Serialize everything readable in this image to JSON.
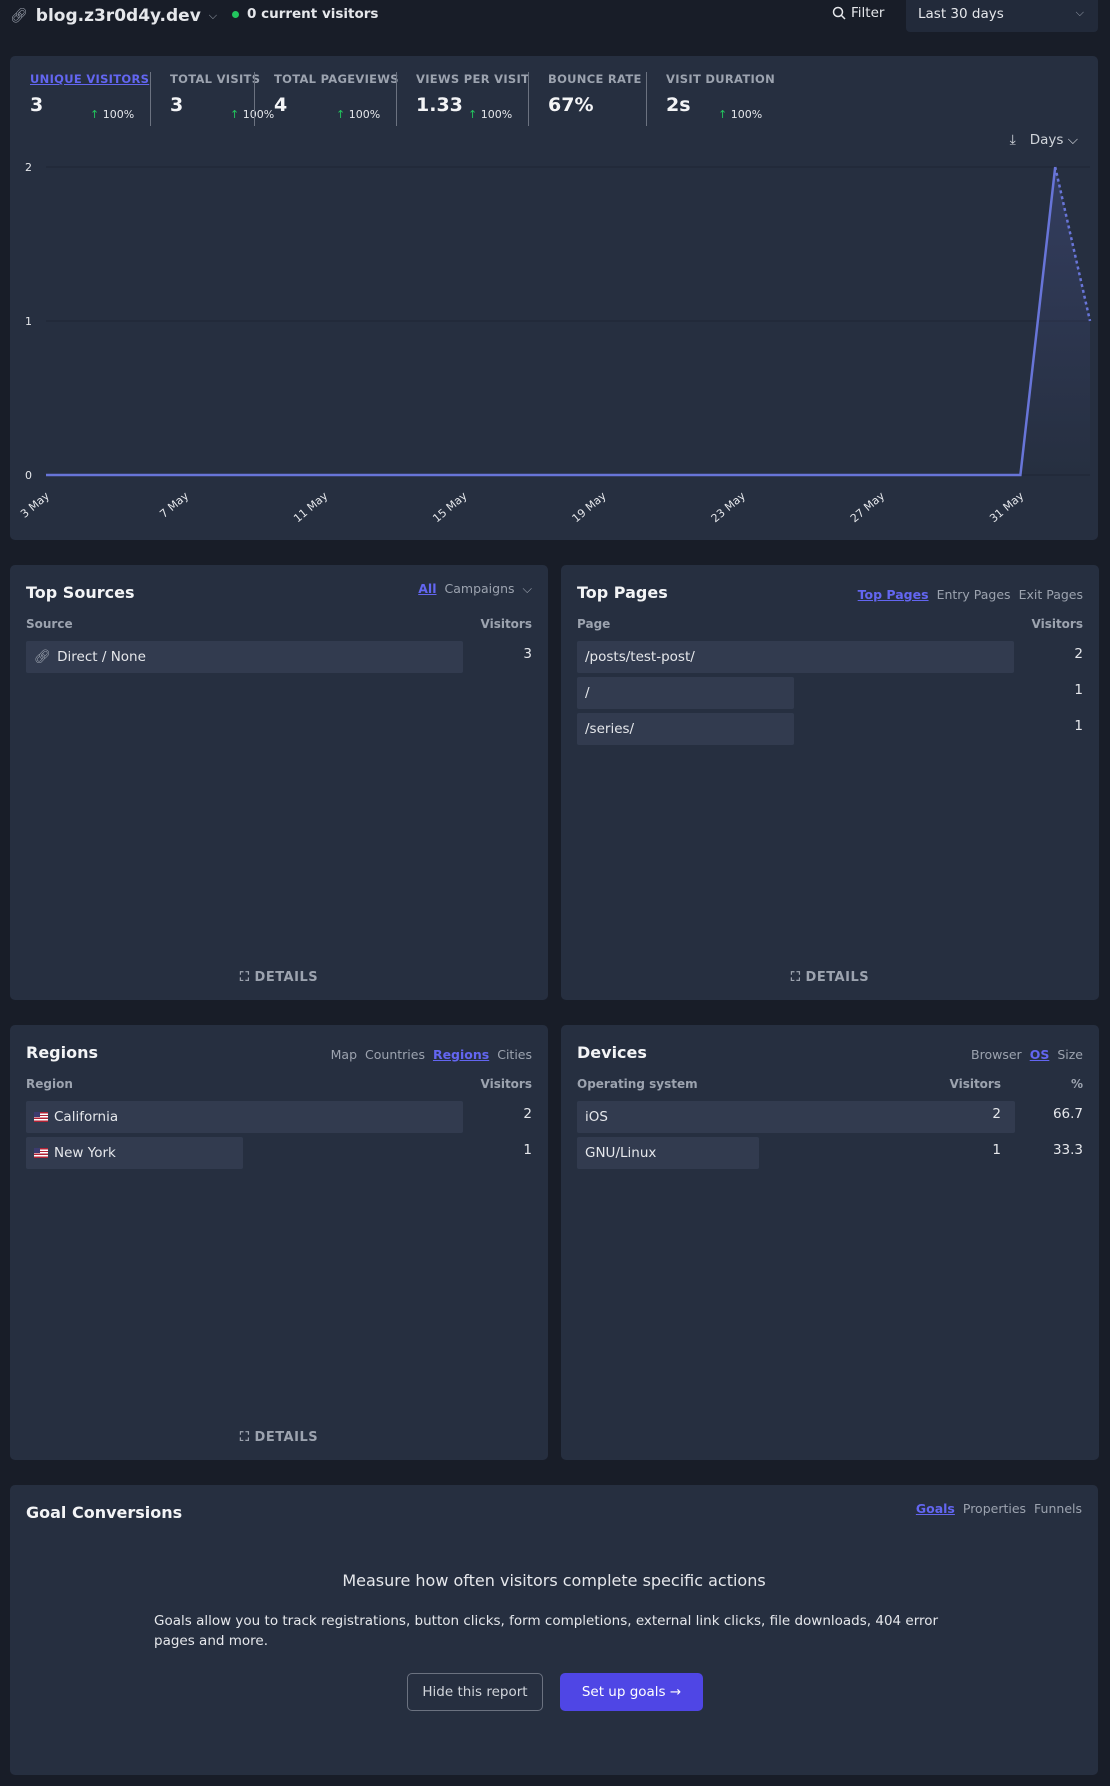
{
  "header": {
    "site": "blog.z3r0d4y.dev",
    "visitors": "0 current visitors",
    "filter": "Filter",
    "period": "Last 30 days"
  },
  "stats": [
    {
      "label": "UNIQUE VISITORS",
      "value": "3",
      "change": "100%",
      "active": true
    },
    {
      "label": "TOTAL VISITS",
      "value": "3",
      "change": "100%"
    },
    {
      "label": "TOTAL PAGEVIEWS",
      "value": "4",
      "change": "100%"
    },
    {
      "label": "VIEWS PER VISIT",
      "value": "1.33",
      "change": "100%"
    },
    {
      "label": "BOUNCE RATE",
      "value": "67%",
      "change": ""
    },
    {
      "label": "VISIT DURATION",
      "value": "2s",
      "change": "100%"
    }
  ],
  "interval": "Days",
  "chart_data": {
    "type": "line",
    "x": [
      "3 May",
      "4 May",
      "5 May",
      "6 May",
      "7 May",
      "8 May",
      "9 May",
      "10 May",
      "11 May",
      "12 May",
      "13 May",
      "14 May",
      "15 May",
      "16 May",
      "17 May",
      "18 May",
      "19 May",
      "20 May",
      "21 May",
      "22 May",
      "23 May",
      "24 May",
      "25 May",
      "26 May",
      "27 May",
      "28 May",
      "29 May",
      "30 May",
      "31 May",
      "1 Jun",
      "2 Jun"
    ],
    "values": [
      0,
      0,
      0,
      0,
      0,
      0,
      0,
      0,
      0,
      0,
      0,
      0,
      0,
      0,
      0,
      0,
      0,
      0,
      0,
      0,
      0,
      0,
      0,
      0,
      0,
      0,
      0,
      0,
      0,
      2,
      1
    ],
    "xticks": [
      "3 May",
      "7 May",
      "11 May",
      "15 May",
      "19 May",
      "23 May",
      "27 May",
      "31 May"
    ],
    "yticks": [
      "0",
      "1",
      "2"
    ],
    "ylim": [
      0,
      2
    ],
    "grid": true,
    "color": "#6875d8",
    "partial_last": true
  },
  "sources": {
    "title": "Top Sources",
    "tabs": [
      "All",
      "Campaigns"
    ],
    "col1": "Source",
    "col2": "Visitors",
    "rows": [
      {
        "label": "Direct / None",
        "value": "3",
        "frac": 1
      }
    ],
    "details": "DETAILS"
  },
  "pages": {
    "title": "Top Pages",
    "tabs": [
      "Top Pages",
      "Entry Pages",
      "Exit Pages"
    ],
    "col1": "Page",
    "col2": "Visitors",
    "rows": [
      {
        "label": "/posts/test-post/",
        "value": "2",
        "frac": 1
      },
      {
        "label": "/",
        "value": "1",
        "frac": 0.5
      },
      {
        "label": "/series/",
        "value": "1",
        "frac": 0.5
      }
    ],
    "details": "DETAILS"
  },
  "regions": {
    "title": "Regions",
    "tabs": [
      "Map",
      "Countries",
      "Regions",
      "Cities"
    ],
    "col1": "Region",
    "col2": "Visitors",
    "rows": [
      {
        "label": "California",
        "value": "2",
        "frac": 1
      },
      {
        "label": "New York",
        "value": "1",
        "frac": 0.5
      }
    ],
    "details": "DETAILS"
  },
  "devices": {
    "title": "Devices",
    "tabs": [
      "Browser",
      "OS",
      "Size"
    ],
    "col1": "Operating system",
    "col2": "Visitors",
    "col3": "%",
    "rows": [
      {
        "label": "iOS",
        "value": "2",
        "pct": "66.7",
        "frac": 1
      },
      {
        "label": "GNU/Linux",
        "value": "1",
        "pct": "33.3",
        "frac": 0.5
      }
    ]
  },
  "goals": {
    "title": "Goal Conversions",
    "tabs": [
      "Goals",
      "Properties",
      "Funnels"
    ],
    "heading": "Measure how often visitors complete specific actions",
    "body": "Goals allow you to track registrations, button clicks, form completions, external link clicks, file downloads, 404 error pages and more.",
    "hide": "Hide this report",
    "setup": "Set up goals"
  },
  "colors": {
    "accent": "#6366f1",
    "button": "#4f46e5",
    "positive": "#22c55e"
  }
}
